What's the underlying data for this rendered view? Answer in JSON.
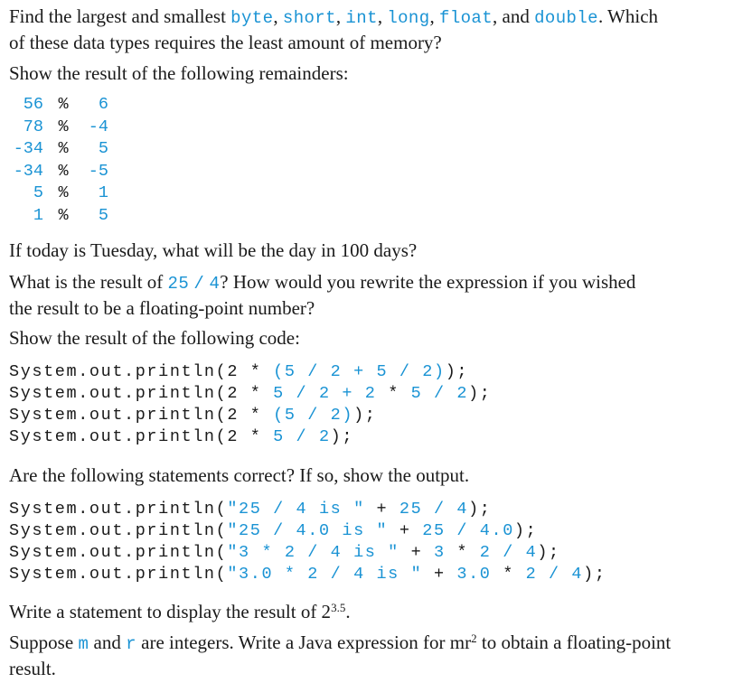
{
  "q1": {
    "pre": "Find the largest and smallest ",
    "types": [
      "byte",
      "short",
      "int",
      "long",
      "float",
      "double"
    ],
    "seps": [
      ", ",
      ", ",
      ", ",
      ", ",
      ", and "
    ],
    "mid": ". Which",
    "line2": "of these data types requires the least amount of memory?"
  },
  "q2": {
    "text": "Show the result of the following remainders:",
    "rows": [
      {
        "a": "56",
        "op": "%",
        "b": "6"
      },
      {
        "a": "78",
        "op": "%",
        "b": "-4"
      },
      {
        "a": "-34",
        "op": "%",
        "b": "5"
      },
      {
        "a": "-34",
        "op": "%",
        "b": "-5"
      },
      {
        "a": "5",
        "op": "%",
        "b": "1"
      },
      {
        "a": "1",
        "op": "%",
        "b": "5"
      }
    ]
  },
  "q3": {
    "text": "If today is Tuesday, what will be the day in 100 days?"
  },
  "q4": {
    "pre": "What is the result of ",
    "a": "25",
    "op": "/",
    "b": "4",
    "post": "? How would you rewrite the expression if you wished",
    "line2": "the result to be a floating-point number?"
  },
  "q5": {
    "text": "Show the result of the following code:",
    "lines": [
      [
        [
          "System.out.println(2 ",
          "k"
        ],
        [
          "* ",
          "k"
        ],
        [
          "(5 / 2 + 5 / 2)",
          "b"
        ],
        [
          ");",
          "k"
        ]
      ],
      [
        [
          "System.out.println(2 ",
          "k"
        ],
        [
          "* ",
          "k"
        ],
        [
          "5 / 2 + 2 ",
          "b"
        ],
        [
          "* ",
          "k"
        ],
        [
          "5 / 2",
          "b"
        ],
        [
          ");",
          "k"
        ]
      ],
      [
        [
          "System.out.println(2 ",
          "k"
        ],
        [
          "* ",
          "k"
        ],
        [
          "(5 / 2)",
          "b"
        ],
        [
          ");",
          "k"
        ]
      ],
      [
        [
          "System.out.println(2 ",
          "k"
        ],
        [
          "* ",
          "k"
        ],
        [
          "5 / 2",
          "b"
        ],
        [
          ");",
          "k"
        ]
      ]
    ]
  },
  "q6": {
    "text": "Are the following statements correct? If so, show the output.",
    "lines": [
      [
        [
          "System.out.println(",
          "k"
        ],
        [
          "\"25 / 4 is \"",
          "b"
        ],
        [
          " + ",
          "k"
        ],
        [
          "25 / 4",
          "b"
        ],
        [
          ");",
          "k"
        ]
      ],
      [
        [
          "System.out.println(",
          "k"
        ],
        [
          "\"25 / 4.0 is \"",
          "b"
        ],
        [
          " + ",
          "k"
        ],
        [
          "25 / 4.0",
          "b"
        ],
        [
          ");",
          "k"
        ]
      ],
      [
        [
          "System.out.println(",
          "k"
        ],
        [
          "\"3 * 2 / 4 is \"",
          "b"
        ],
        [
          " + ",
          "k"
        ],
        [
          "3 ",
          "b"
        ],
        [
          "* ",
          "k"
        ],
        [
          "2 / 4",
          "b"
        ],
        [
          ");",
          "k"
        ]
      ],
      [
        [
          "System.out.println(",
          "k"
        ],
        [
          "\"3.0 * 2 / 4 is \"",
          "b"
        ],
        [
          " + ",
          "k"
        ],
        [
          "3.0 ",
          "b"
        ],
        [
          "* ",
          "k"
        ],
        [
          "2 / 4",
          "b"
        ],
        [
          ");",
          "k"
        ]
      ]
    ]
  },
  "q7": {
    "pre": "Write a statement to display the result of 2",
    "sup": "3.5",
    "post": "."
  },
  "q8": {
    "pre": "Suppose ",
    "m": "m",
    "and": " and ",
    "r": "r",
    "mid": " are integers. Write a Java expression for mr",
    "sup": "2",
    "post": " to obtain a floating-point",
    "line2": "result."
  }
}
